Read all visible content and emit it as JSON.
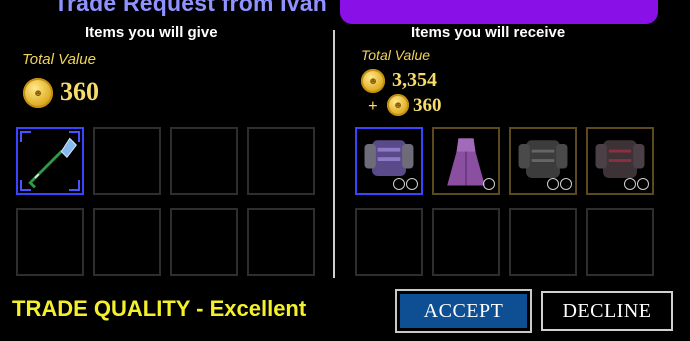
{
  "title": "Trade Request from Ivan",
  "give": {
    "heading": "Items you will give",
    "total_label": "Total Value",
    "total_value": "360"
  },
  "receive": {
    "heading": "Items you will receive",
    "total_label": "Total Value",
    "item_value": "3,354",
    "plus": "+",
    "coin_value": "360"
  },
  "quality": "TRADE QUALITY - Excellent",
  "buttons": {
    "accept": "ACCEPT",
    "decline": "DECLINE"
  },
  "icons": {
    "coin": "gold-coin-icon",
    "shovel": "shovel-icon",
    "armor": "armor-icon",
    "dress": "dress-icon",
    "stars": "rarity-rings-icon"
  },
  "colors": {
    "title": "#8f93ff",
    "gold": "#f6dc6a",
    "quality": "#f4f12a",
    "accept_bg": "#0e4f93",
    "selected_border": "#3a43ff"
  }
}
